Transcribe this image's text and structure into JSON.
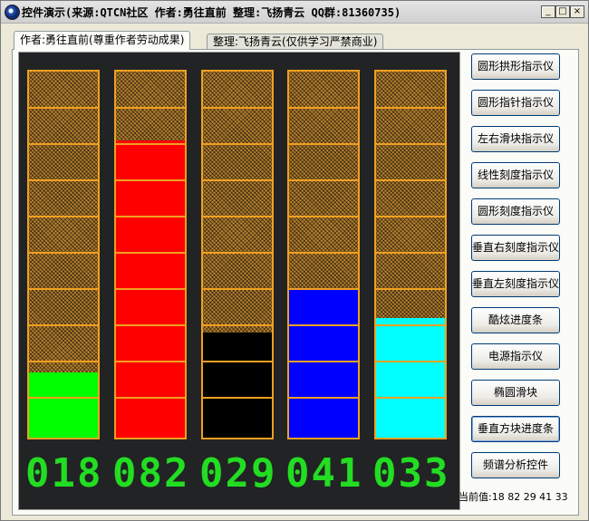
{
  "window": {
    "title": "控件演示(来源:QTCN社区 作者:勇往直前 整理:飞扬青云 QQ群:81360735)",
    "minimize_symbol": "_",
    "maximize_symbol": "□",
    "close_symbol": "×"
  },
  "tabs": [
    {
      "label": "作者:勇往直前(尊重作者劳动成果)",
      "active": true
    },
    {
      "label": "整理:飞扬青云(仅供学习严禁商业)",
      "active": false
    }
  ],
  "meters": [
    {
      "value": 18,
      "digits": "018",
      "color": "#00ff00"
    },
    {
      "value": 82,
      "digits": "082",
      "color": "#ff0000"
    },
    {
      "value": 29,
      "digits": "029",
      "color": "#000000"
    },
    {
      "value": 41,
      "digits": "041",
      "color": "#0000ff"
    },
    {
      "value": 33,
      "digits": "033",
      "color": "#00ffff"
    }
  ],
  "buttons": [
    "圆形拱形指示仪",
    "圆形指针指示仪",
    "左右滑块指示仪",
    "线性刻度指示仪",
    "圆形刻度指示仪",
    "垂直右刻度指示仪",
    "垂直左刻度指示仪",
    "酷炫进度条",
    "电源指示仪",
    "椭圆滑块",
    "垂直方块进度条",
    "频谱分析控件"
  ],
  "current_values_label": "当前值:18 82 29 41 33",
  "colors": {
    "bar_border": "#f0a020",
    "digit_color": "#22dd22",
    "panel_background": "#222324"
  }
}
